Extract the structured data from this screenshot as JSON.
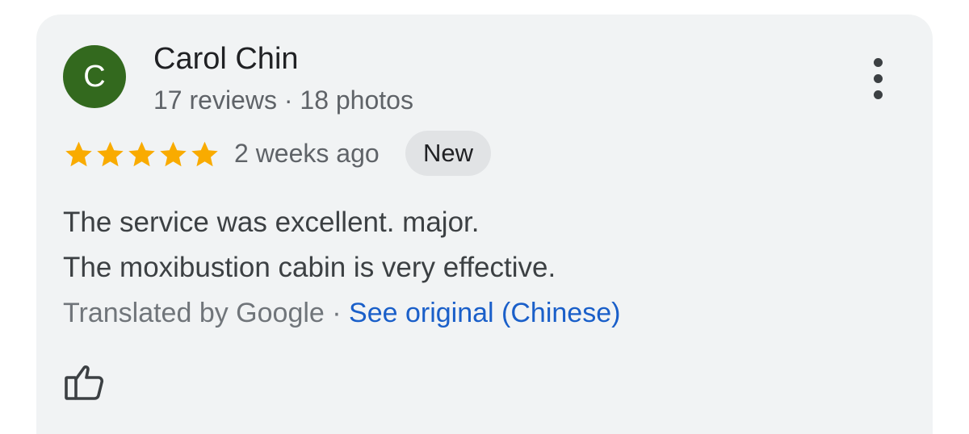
{
  "review": {
    "author_initial": "C",
    "author_name": "Carol Chin",
    "author_meta": "17 reviews · 18 photos",
    "rating": 5,
    "rating_max": 5,
    "time_ago": "2 weeks ago",
    "badge": "New",
    "text_lines": [
      "The service was excellent. major.",
      "The moxibustion cabin is very effective."
    ],
    "translated_label": "Translated by Google",
    "separator": " · ",
    "see_original_label": "See original (Chinese)"
  },
  "icons": {
    "more": "more-vert-icon",
    "star": "star-icon",
    "like": "thumb-up-icon"
  },
  "colors": {
    "avatar_bg": "#33691e",
    "star": "#f9ab00",
    "link": "#1a5fc9",
    "card_bg": "#f1f3f4"
  }
}
